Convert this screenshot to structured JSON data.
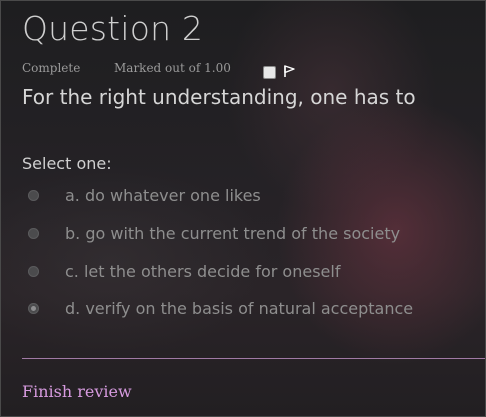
{
  "question": {
    "title": "Question 2",
    "state": "Complete",
    "grade": "Marked out of 1.00",
    "text": "For the right understanding, one has to",
    "prompt": "Select one:",
    "flag_icon": "flag-icon"
  },
  "options": [
    {
      "label": "a. do whatever one likes",
      "selected": false
    },
    {
      "label": "b. go with the current trend of the society",
      "selected": false
    },
    {
      "label": "c. let the others decide for oneself",
      "selected": false
    },
    {
      "label": "d. verify on the basis of natural acceptance",
      "selected": true
    }
  ],
  "footer": {
    "finish_label": "Finish review"
  },
  "colors": {
    "link": "#d79be0",
    "divider": "#a07aa4"
  }
}
